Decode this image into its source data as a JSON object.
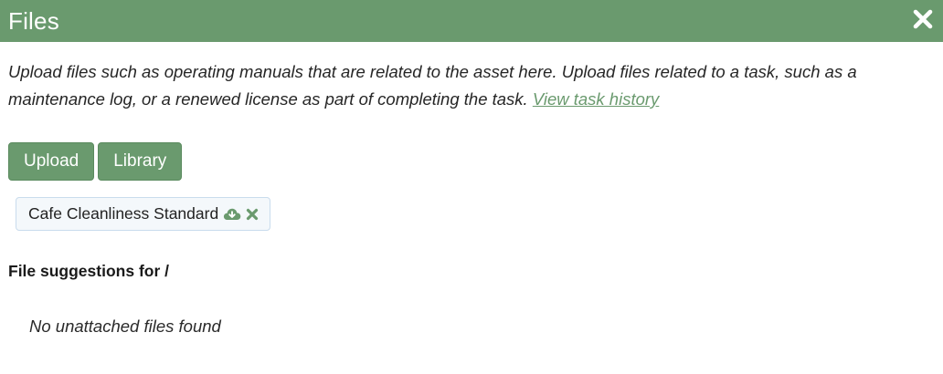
{
  "header": {
    "title": "Files",
    "close_icon": "close-icon"
  },
  "intro": {
    "text": "Upload files such as operating manuals that are related to the asset here. Upload files related to a task, such as a maintenance log, or a renewed license as part of completing the task. ",
    "link_label": "View task history"
  },
  "actions": {
    "upload_label": "Upload",
    "library_label": "Library"
  },
  "attached_files": [
    {
      "name": "Cafe Cleanliness Standard",
      "download_icon": "cloud-download-icon",
      "remove_icon": "remove-icon"
    }
  ],
  "suggestions": {
    "heading": "File suggestions for /",
    "empty_text": "No unattached files found"
  },
  "colors": {
    "accent": "#6a9a6e",
    "chip_border": "#c9dced",
    "chip_background": "#f4f8fb"
  }
}
